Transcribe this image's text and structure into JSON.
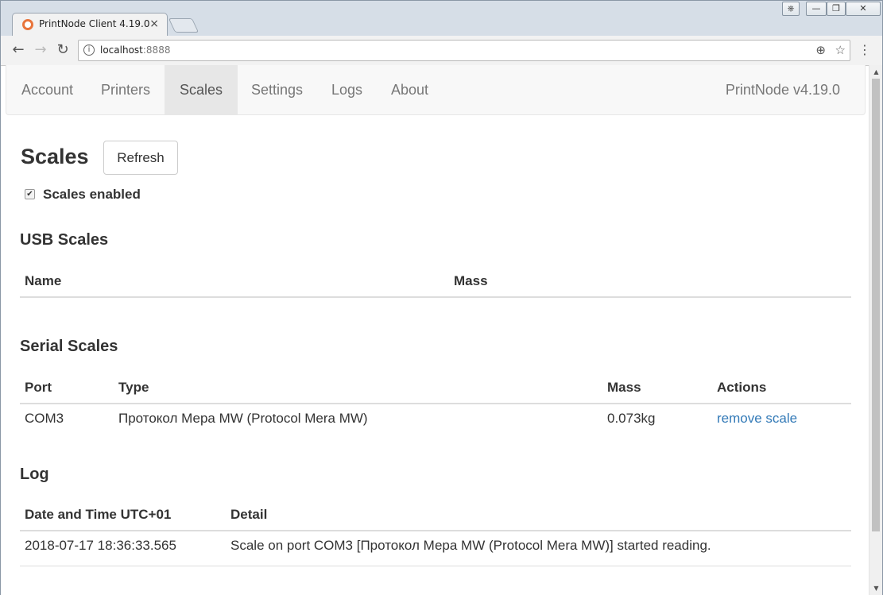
{
  "browser": {
    "tab_title": "PrintNode Client 4.19.0",
    "tab_close": "×",
    "url_host": "localhost",
    "url_port": ":8888",
    "window_controls": [
      "⎈",
      "—",
      "❐",
      "✕"
    ]
  },
  "nav": {
    "items": [
      "Account",
      "Printers",
      "Scales",
      "Settings",
      "Logs",
      "About"
    ],
    "active": "Scales",
    "brand": "PrintNode v4.19.0"
  },
  "page": {
    "title": "Scales",
    "refresh_label": "Refresh",
    "scales_enabled_label": "Scales enabled",
    "scales_enabled": true
  },
  "usb": {
    "heading": "USB Scales",
    "columns": [
      "Name",
      "Mass"
    ]
  },
  "serial": {
    "heading": "Serial Scales",
    "columns": [
      "Port",
      "Type",
      "Mass",
      "Actions"
    ],
    "rows": [
      {
        "port": "COM3",
        "type": "Протокол Мера MW (Protocol Mera MW)",
        "mass": "0.073kg",
        "action": "remove scale"
      }
    ]
  },
  "log": {
    "heading": "Log",
    "columns": [
      "Date and Time UTC+01",
      "Detail"
    ],
    "rows": [
      {
        "datetime": "2018-07-17 18:36:33.565",
        "detail": "Scale on port COM3 [Протокол Мера MW (Protocol Mera MW)] started reading."
      }
    ]
  }
}
